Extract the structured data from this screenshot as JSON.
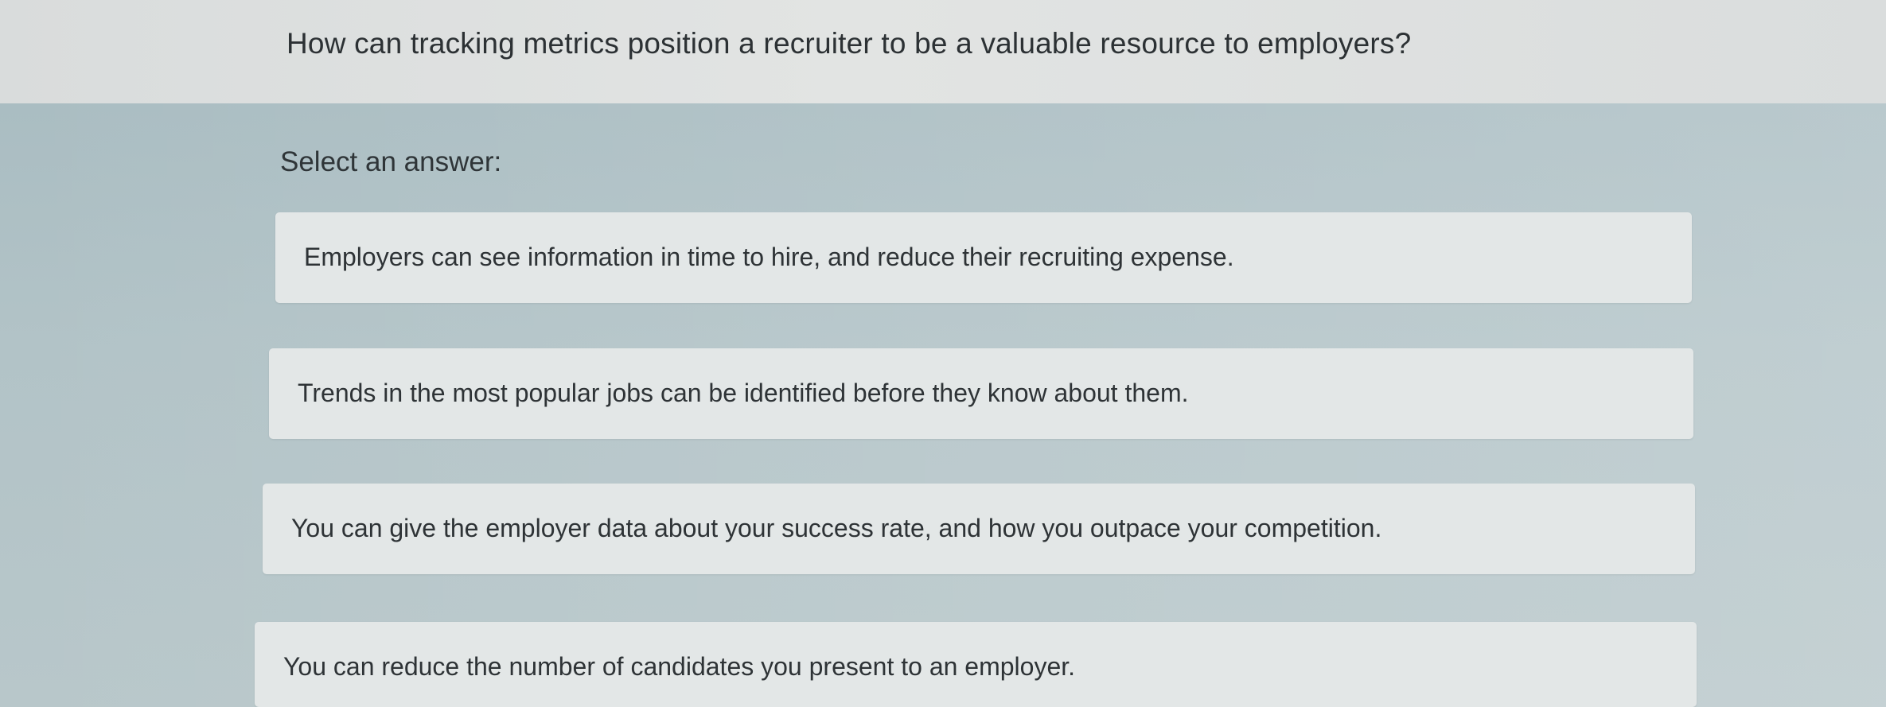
{
  "question": {
    "text": "How can tracking metrics position a recruiter to be a valuable resource to employers?"
  },
  "prompt_label": "Select an answer:",
  "options": [
    {
      "label": "Employers can see information in time to hire, and reduce their recruiting expense."
    },
    {
      "label": "Trends in the most popular jobs can be identified before they know about them."
    },
    {
      "label": "You can give the employer data about your success rate, and how you outpace your competition."
    },
    {
      "label": "You can reduce the number of candidates you present to an employer."
    }
  ]
}
